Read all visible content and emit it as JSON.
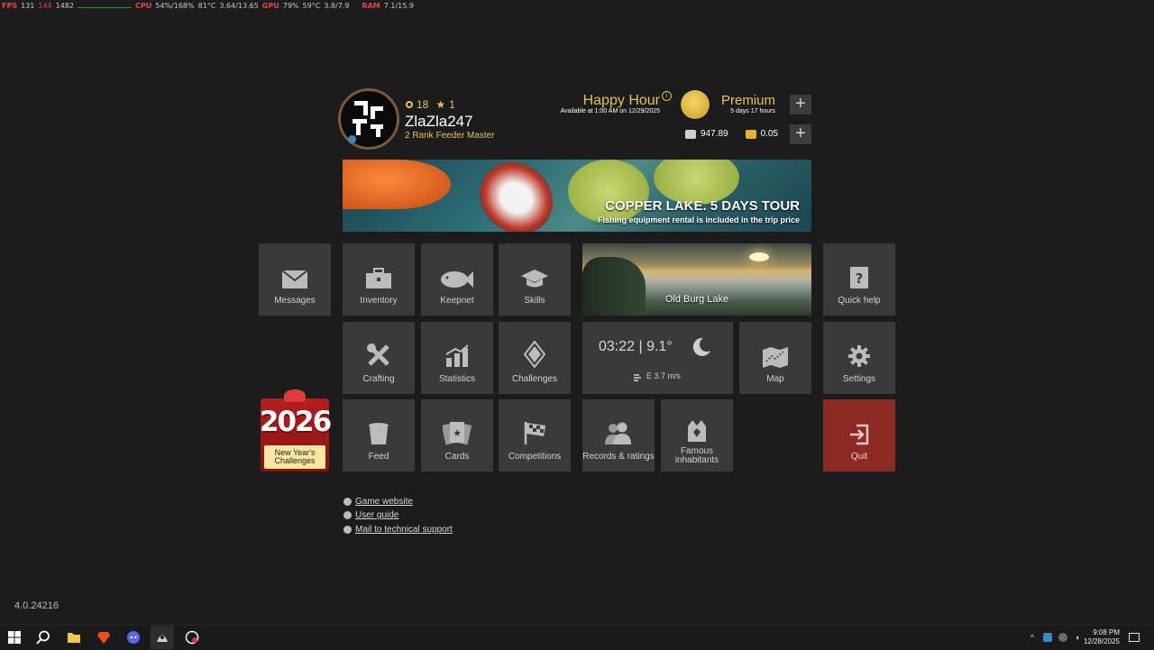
{
  "overlay": {
    "fps_label": "FPS",
    "fps": "131",
    "fps2": "144",
    "fps3": "1482",
    "cpu_label": "CPU",
    "cpu": "54%/168%",
    "temp1": "81°C",
    "mem1": "3.64/13.65",
    "gpu_label": "GPU",
    "gpu": "79%",
    "temp2": "59°C",
    "mem2": "3.8/7.9",
    "ram_label": "RAM",
    "ram": "7.1/15.9"
  },
  "player": {
    "level": "18",
    "stars": "1",
    "name": "ZlaZla247",
    "rank": "2 Rank Feeder Master"
  },
  "happy_hour": {
    "title": "Happy Hour",
    "subtitle": "Available at 1:00 AM on 12/29/2025",
    "info": "i"
  },
  "premium": {
    "title": "Premium",
    "subtitle": "5 days 17 hours"
  },
  "currency": {
    "silver": "947.89",
    "gold": "0.05"
  },
  "plus_symbol": "+",
  "banner": {
    "title": "COPPER LAKE. 5 DAYS TOUR",
    "subtitle": "Fishing equipment rental is included in the trip price"
  },
  "tiles": {
    "messages": "Messages",
    "inventory": "Inventory",
    "keepnet": "Keepnet",
    "skills": "Skills",
    "quick_help": "Quick help",
    "crafting": "Crafting",
    "statistics": "Statistics",
    "challenges": "Challenges",
    "map": "Map",
    "settings": "Settings",
    "feed": "Feed",
    "cards": "Cards",
    "competitions": "Competitions",
    "records": "Records & ratings",
    "famous": "Famous inhabitants",
    "quit": "Quit"
  },
  "location": {
    "name": "Old Burg Lake",
    "time": "03:22 | 9.1°",
    "wind": "E  3.7 m/s"
  },
  "new_year": {
    "year": "2026",
    "label": "New Year's Challenges"
  },
  "links": [
    "Game website",
    "User guide",
    "Mail to technical support"
  ],
  "version": "4.0.24216",
  "clock": {
    "time": "9:08 PM",
    "date": "12/28/2025"
  },
  "colors": {
    "gold": "#e6c35a",
    "tile": "#3a3a3a",
    "quit": "#8b2a22",
    "background": "#1c1c1c"
  }
}
